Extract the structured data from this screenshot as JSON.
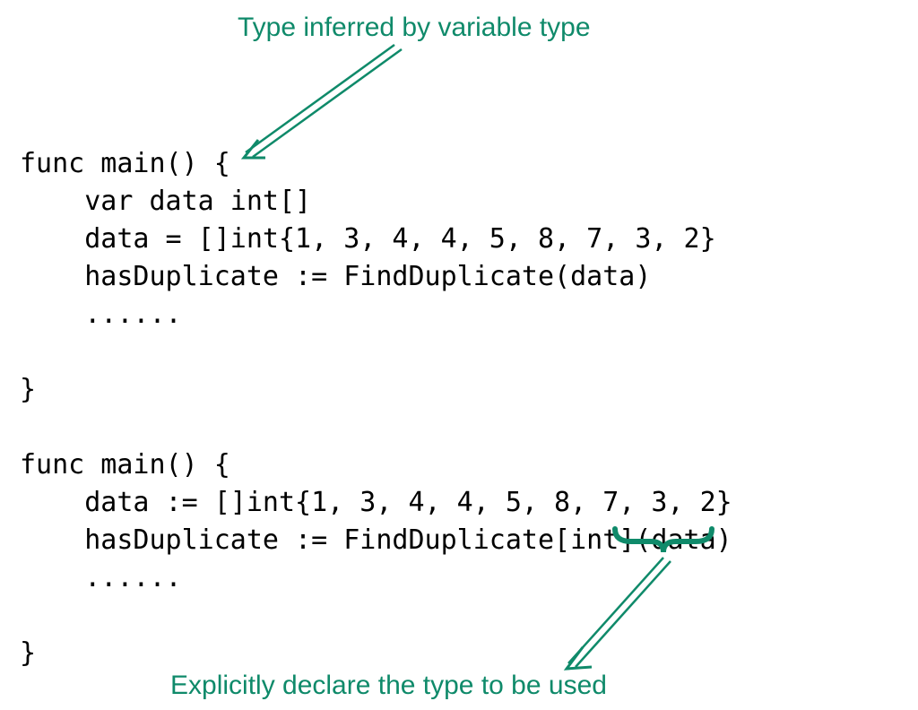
{
  "annotations": {
    "top": "Type inferred by variable type",
    "bottom": "Explicitly declare the type to be used"
  },
  "code": {
    "block1_line1": "func main() {",
    "block1_line2": "    var data int[]",
    "block1_line3": "    data = []int{1, 3, 4, 4, 5, 8, 7, 3, 2}",
    "block1_line4": "    hasDuplicate := FindDuplicate(data)",
    "block1_line5": "    ......",
    "block1_line6": "",
    "block1_line7": "}",
    "block2_line1": "func main() {",
    "block2_line2": "    data := []int{1, 3, 4, 4, 5, 8, 7, 3, 2}",
    "block2_line3": "    hasDuplicate := FindDuplicate[int](data)",
    "block2_line4": "    ......",
    "block2_line5": "",
    "block2_line6": "}"
  },
  "colors": {
    "annotation": "#0f8a6a",
    "code": "#000000"
  }
}
